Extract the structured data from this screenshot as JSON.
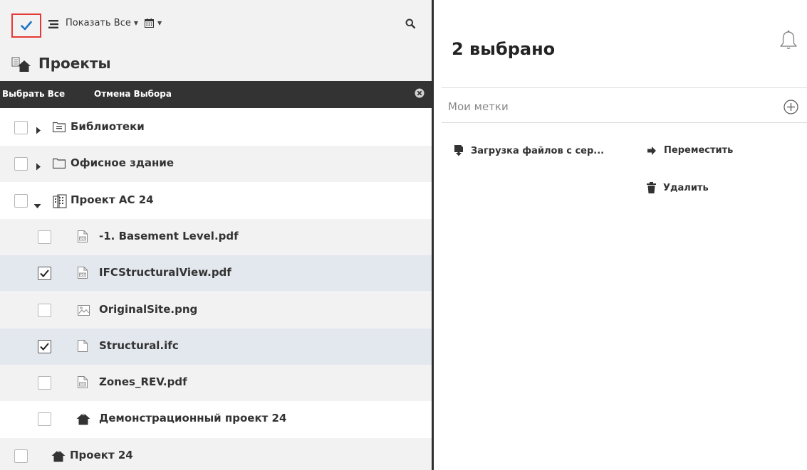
{
  "toolbar": {
    "show_all_label": "Показать Все",
    "icons": [
      "check-icon",
      "list-icon",
      "calendar-icon",
      "search-icon"
    ]
  },
  "projects": {
    "title": "Проекты"
  },
  "selection_bar": {
    "select_all": "Выбрать Все",
    "cancel_selection": "Отмена Выбора"
  },
  "tree": [
    {
      "label": "Библиотеки",
      "icon": "library-folder-icon",
      "expander": "collapsed",
      "checked": false,
      "level": 0
    },
    {
      "label": "Офисное здание",
      "icon": "folder-icon",
      "expander": "collapsed",
      "checked": false,
      "level": 0
    },
    {
      "label": "Проект AC 24",
      "icon": "building-icon",
      "expander": "expanded",
      "checked": false,
      "level": 0
    },
    {
      "label": "-1. Basement Level.pdf",
      "icon": "pdf-file-icon",
      "expander": "none",
      "checked": false,
      "level": 1
    },
    {
      "label": "IFCStructuralView.pdf",
      "icon": "pdf-file-icon",
      "expander": "none",
      "checked": true,
      "level": 1
    },
    {
      "label": "OriginalSite.png",
      "icon": "image-file-icon",
      "expander": "none",
      "checked": false,
      "level": 1
    },
    {
      "label": "Structural.ifc",
      "icon": "file-icon",
      "expander": "none",
      "checked": true,
      "level": 1
    },
    {
      "label": "Zones_REV.pdf",
      "icon": "pdf-file-icon",
      "expander": "none",
      "checked": false,
      "level": 1
    },
    {
      "label": "Демонстрационный проект 24",
      "icon": "project-house-icon",
      "expander": "none",
      "checked": false,
      "level": 1
    },
    {
      "label": "Проект 24",
      "icon": "project-house-icon",
      "expander": "none",
      "checked": false,
      "level": 0
    }
  ],
  "details": {
    "selected_count_text": "2 выбрано",
    "tags_label": "Мои метки",
    "actions": {
      "download": "Загрузка файлов с сер...",
      "move": "Переместить",
      "delete": "Удалить"
    }
  },
  "colors": {
    "selection_bar": "#333333",
    "row_alt": "#f2f2f2",
    "row_selected": "#e3e8ee",
    "check_accent": "#1a73c8",
    "highlight_box": "#e53935"
  }
}
